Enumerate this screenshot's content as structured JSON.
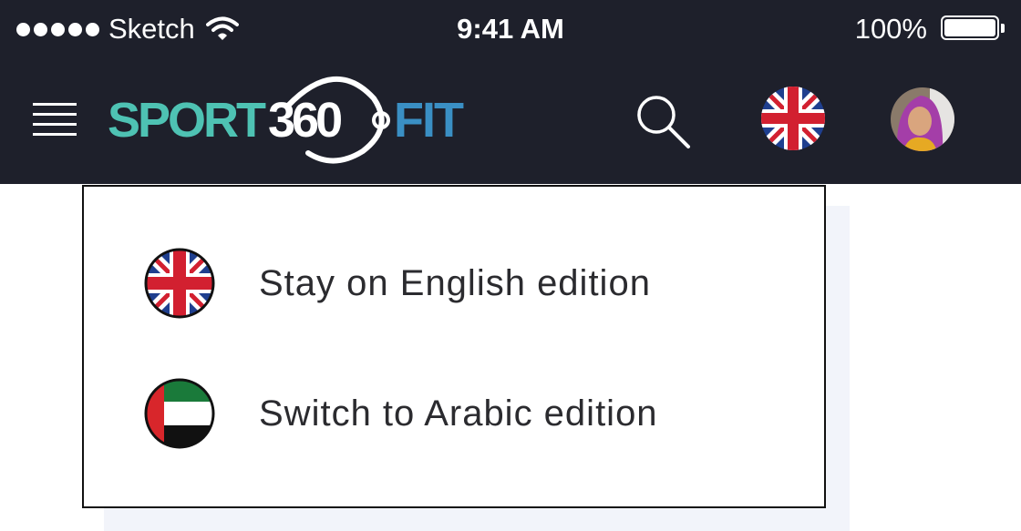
{
  "status_bar": {
    "carrier": "Sketch",
    "time": "9:41 AM",
    "battery_percent": "100%"
  },
  "header": {
    "logo": {
      "text_sport": "SPORT",
      "text_360": "360",
      "text_fit": "FIT",
      "colors": {
        "sport": "#4ec2b3",
        "fit": "#3a8fc4",
        "ring": "#ffffff"
      }
    },
    "icons": {
      "menu": "hamburger-menu-icon",
      "search": "search-icon",
      "language": "uk-flag-icon",
      "profile": "user-avatar"
    }
  },
  "language_menu": {
    "options": [
      {
        "label": "Stay on English edition",
        "flag": "uk-flag-icon"
      },
      {
        "label": "Switch to Arabic edition",
        "flag": "uae-flag-icon"
      }
    ]
  },
  "colors": {
    "header_bg": "#1e202b",
    "panel_shadow": "#f2f4fa",
    "menu_border": "#111111"
  }
}
